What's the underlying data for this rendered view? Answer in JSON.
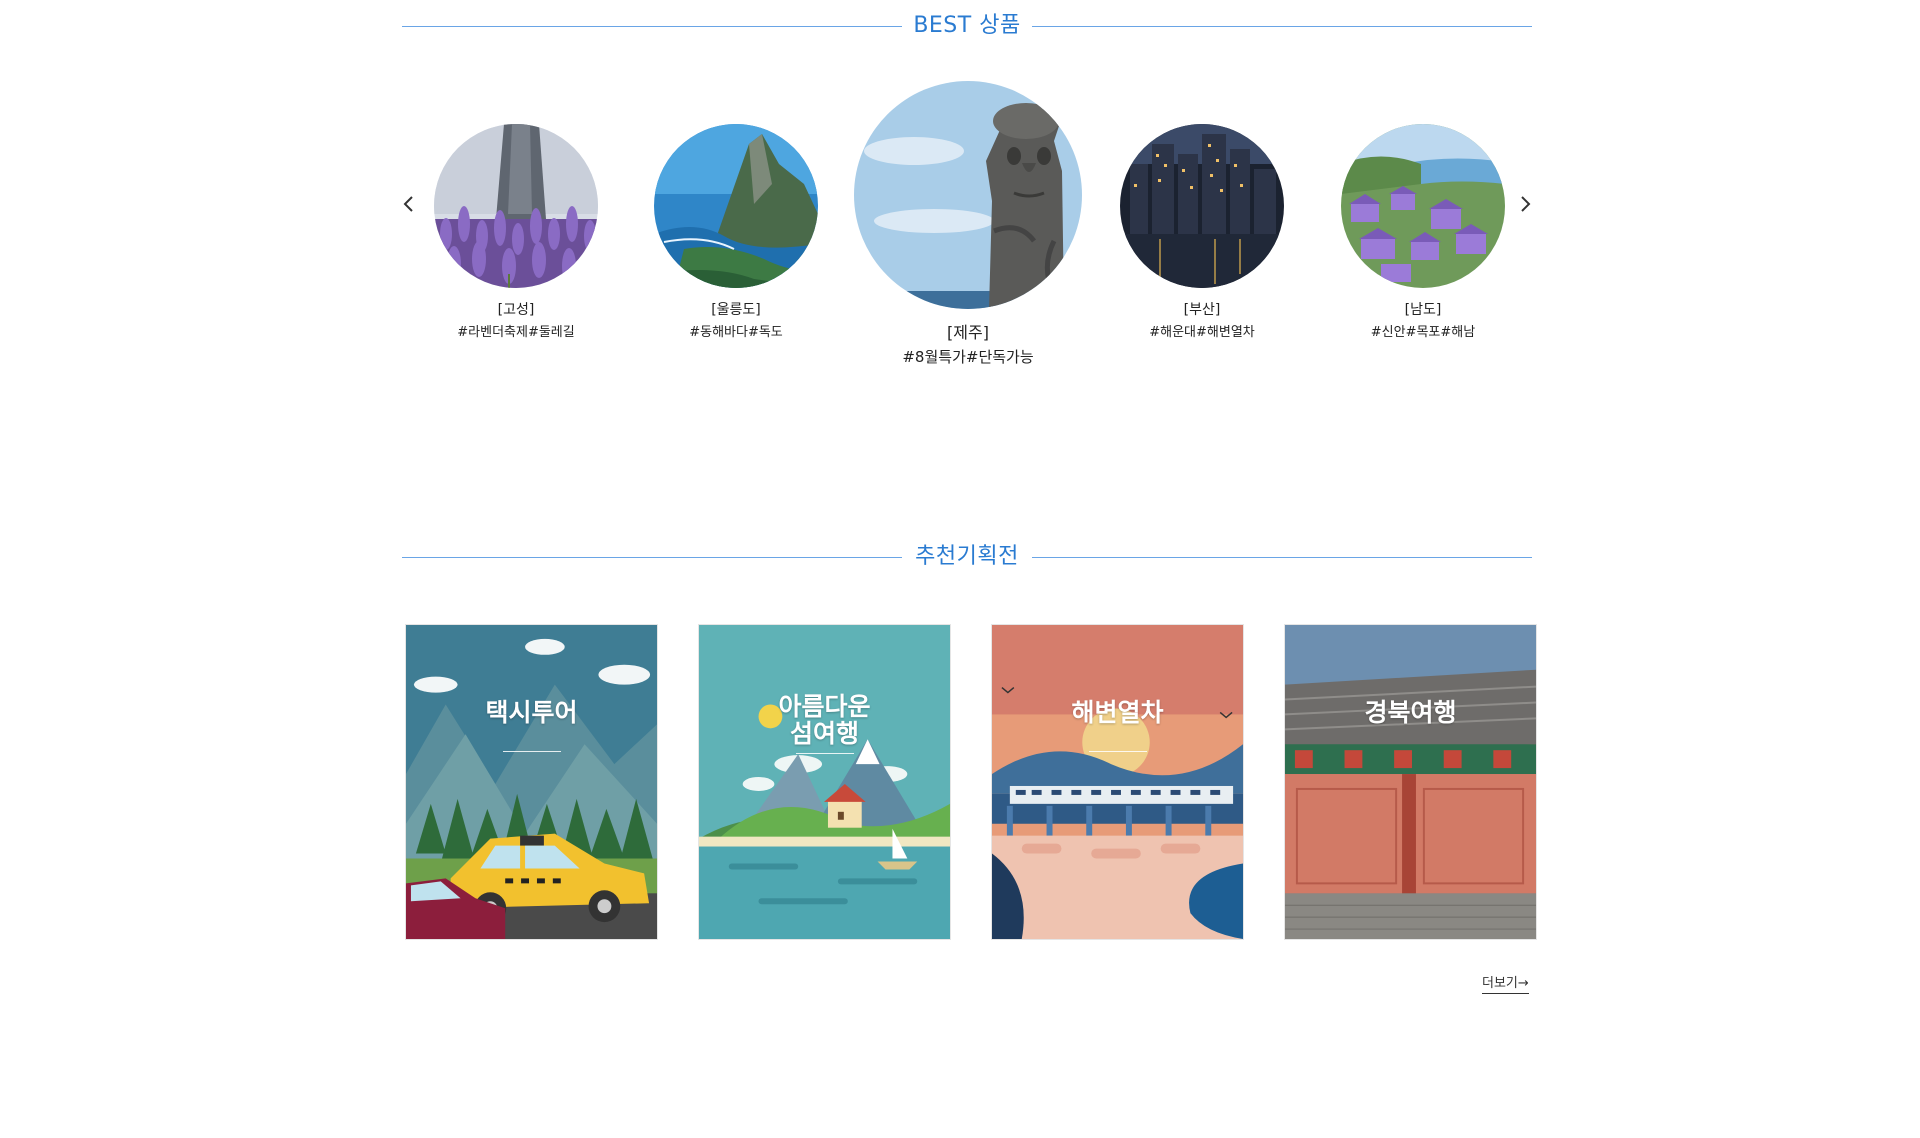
{
  "best_section": {
    "title": "BEST 상품",
    "prev_icon": "chevron-left-icon",
    "next_icon": "chevron-right-icon",
    "items": [
      {
        "region": "[고성]",
        "tags": "#라벤더축제#둘레길"
      },
      {
        "region": "[울릉도]",
        "tags": "#동해바다#독도"
      },
      {
        "region": "[제주]",
        "tags": "#8월특가#단독가능"
      },
      {
        "region": "[부산]",
        "tags": "#해운대#해변열차"
      },
      {
        "region": "[남도]",
        "tags": "#신안#목포#해남"
      }
    ]
  },
  "promo_section": {
    "title": "추천기획전",
    "cards": [
      {
        "title": "택시투어"
      },
      {
        "title": "아름다운\n섬여행"
      },
      {
        "title": "해변열차"
      },
      {
        "title": "경북여행"
      }
    ],
    "more_label": "더보기→"
  },
  "colors": {
    "accent": "#2a7bd1",
    "title_line": "#6aa5e6"
  }
}
